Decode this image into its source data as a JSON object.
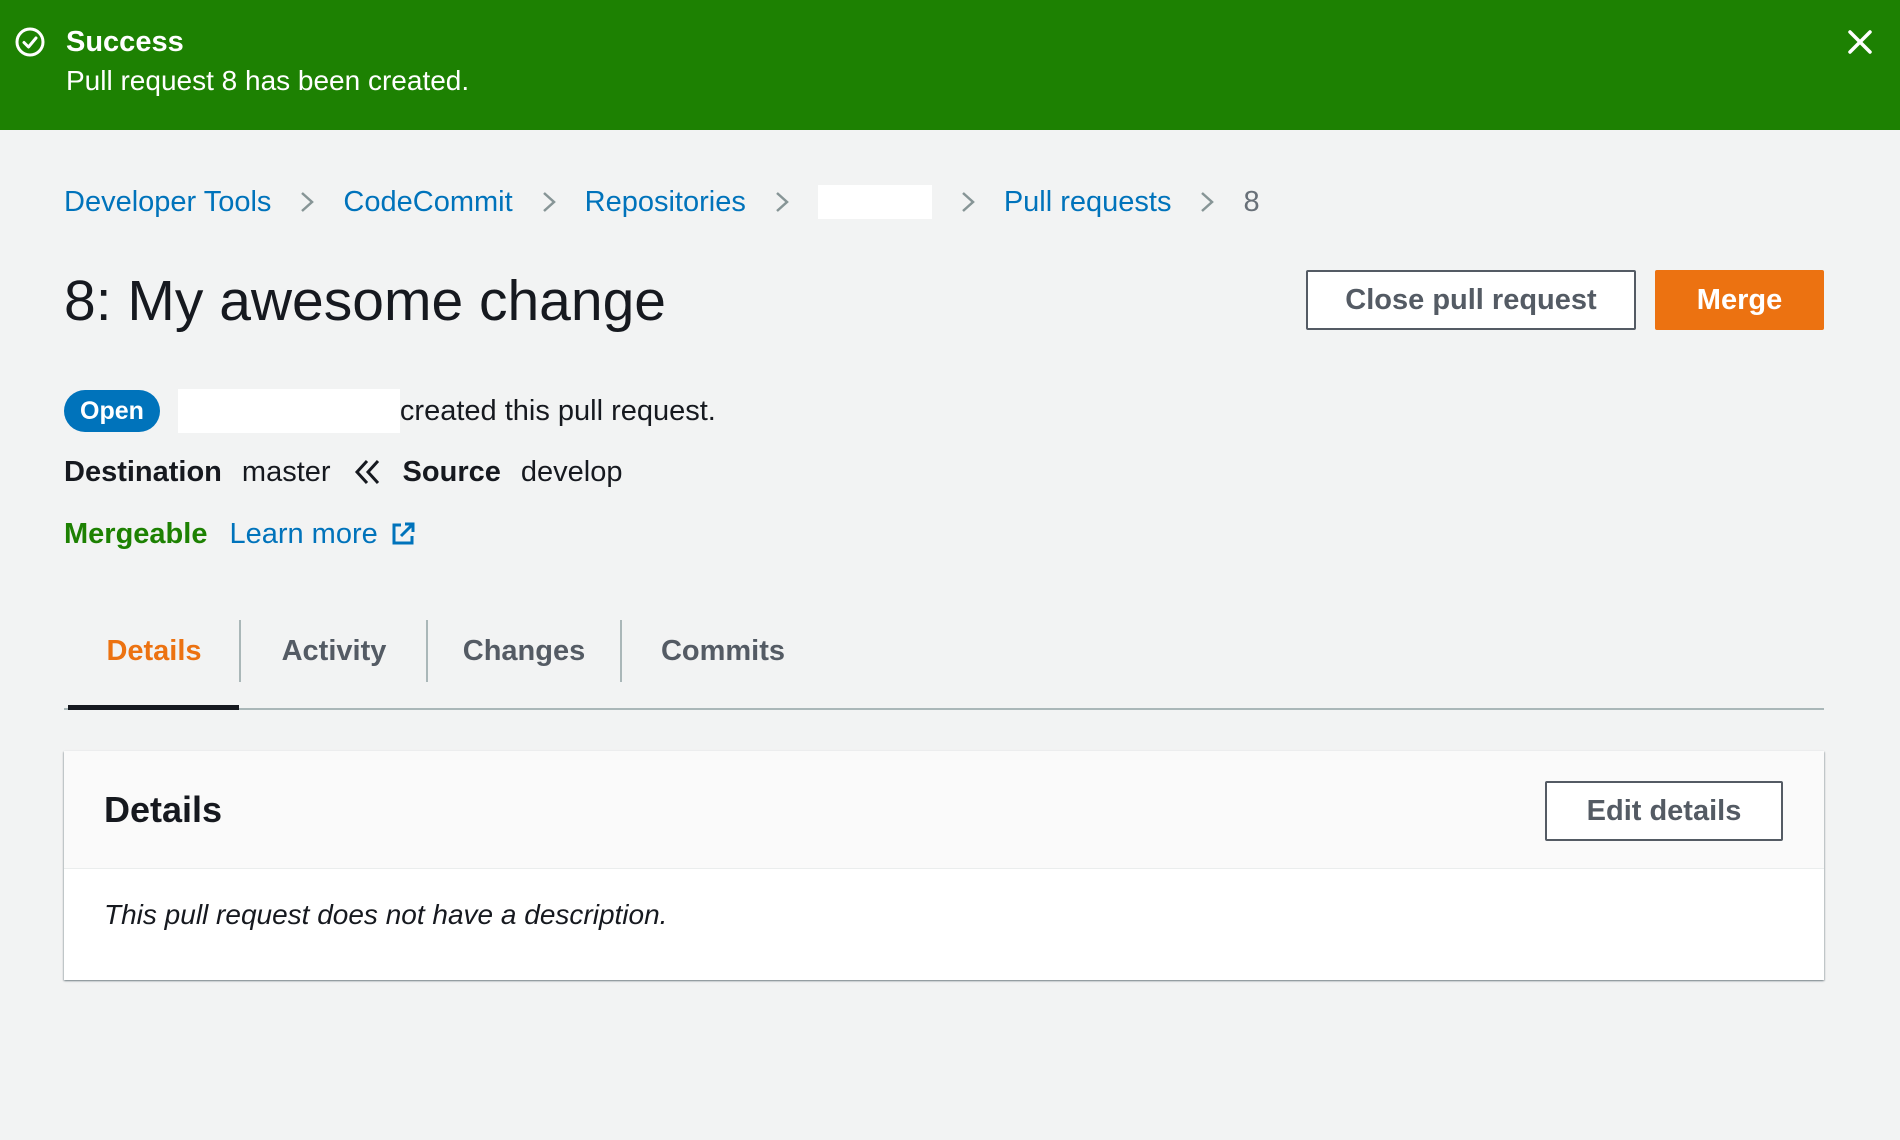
{
  "flash": {
    "type": "success",
    "title": "Success",
    "message": "Pull request 8 has been created.",
    "icon": "check-circle-icon",
    "close_icon": "close-icon",
    "color": "#1d8102"
  },
  "breadcrumb": {
    "items": [
      "Developer Tools",
      "CodeCommit",
      "Repositories",
      "",
      "Pull requests"
    ],
    "current": "8",
    "separator_icon": "chevron-right-icon"
  },
  "header": {
    "title": "8: My awesome change",
    "close_button": "Close pull request",
    "merge_button": "Merge"
  },
  "status": {
    "badge": "Open",
    "created_text": "created this pull request."
  },
  "branches": {
    "destination_label": "Destination",
    "destination_value": "master",
    "arrow_icon": "double-chevron-left-icon",
    "source_label": "Source",
    "source_value": "develop"
  },
  "merge": {
    "status": "Mergeable",
    "learn_more": "Learn more",
    "external_icon": "external-link-icon"
  },
  "tabs": [
    {
      "label": "Details",
      "active": true
    },
    {
      "label": "Activity",
      "active": false
    },
    {
      "label": "Changes",
      "active": false
    },
    {
      "label": "Commits",
      "active": false
    }
  ],
  "details_panel": {
    "title": "Details",
    "edit_button": "Edit details",
    "description": "This pull request does not have a description."
  },
  "colors": {
    "link": "#0073bb",
    "primary": "#ec7211",
    "success": "#1d8102",
    "background": "#f2f3f3"
  }
}
